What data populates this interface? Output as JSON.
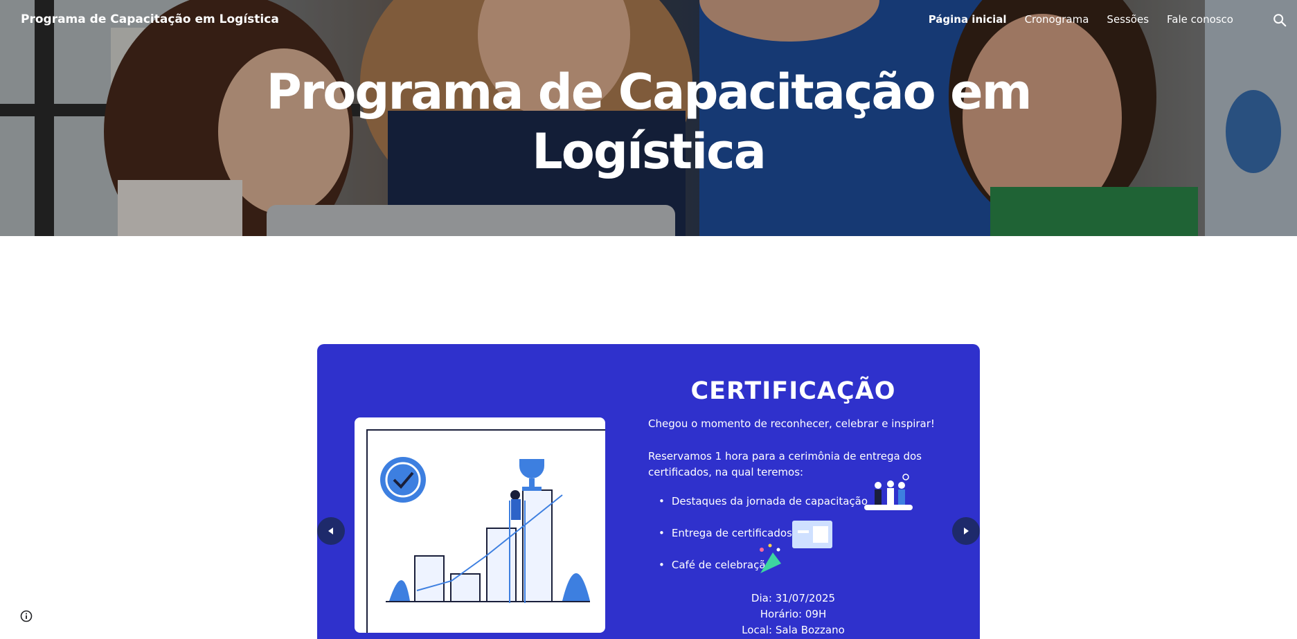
{
  "header": {
    "site_title": "Programa de Capacitação em Logística",
    "nav": [
      {
        "label": "Página inicial",
        "active": true
      },
      {
        "label": "Cronograma",
        "active": false
      },
      {
        "label": "Sessões",
        "active": false
      },
      {
        "label": "Fale conosco",
        "active": false
      }
    ],
    "search_icon": "search-icon"
  },
  "hero": {
    "heading_line1": "Programa de Capacitação em",
    "heading_line2": "Logística"
  },
  "carousel": {
    "title": "CERTIFICAÇÃO",
    "intro": "Chegou o momento de reconhecer, celebrar e inspirar!",
    "description_line1": "Reservamos 1 hora para a cerimônia de entrega dos",
    "description_line2": "certificados, na qual teremos:",
    "bullets": [
      "Destaques da jornada de capacitação",
      "Entrega de certificados",
      "Café de celebração"
    ],
    "event": {
      "date": "Dia: 31/07/2025",
      "time": "Horário: 09H",
      "place": "Local: Sala Bozzano"
    },
    "prev_icon": "chevron-left-icon",
    "next_icon": "chevron-right-icon",
    "background_color": "#2f31cc"
  },
  "footer": {
    "info_icon": "info-icon"
  }
}
